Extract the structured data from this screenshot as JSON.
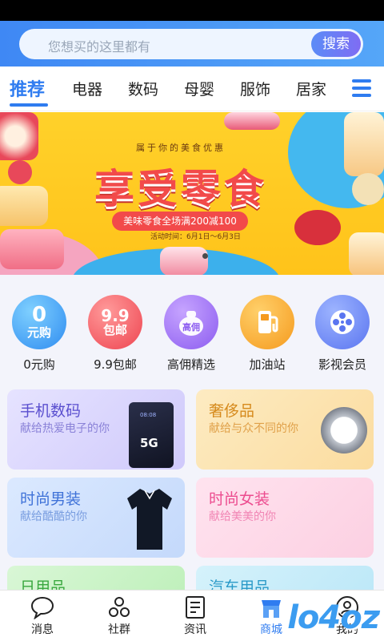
{
  "search": {
    "placeholder": "您想买的这里都有",
    "button": "搜索"
  },
  "tabs": [
    {
      "label": "推荐",
      "active": true
    },
    {
      "label": "电器"
    },
    {
      "label": "数码"
    },
    {
      "label": "母婴"
    },
    {
      "label": "服饰"
    },
    {
      "label": "居家"
    }
  ],
  "banner": {
    "subtitle": "属于你的美食优惠",
    "title": "享受零食",
    "ribbon": "美味零食全场满200减100",
    "date": "活动时间：6月1日～6月3日"
  },
  "quick_icons": [
    {
      "label": "0元购",
      "badge_top": "0",
      "badge_bottom": "元购",
      "color": "#2f8cf0"
    },
    {
      "label": "9.9包邮",
      "badge_top": "9.9",
      "badge_bottom": "包邮",
      "color": "#ee4450"
    },
    {
      "label": "高佣精选",
      "badge_top": "",
      "badge_bottom": "高佣",
      "color": "#8c5cf0"
    },
    {
      "label": "加油站",
      "badge_top": "",
      "badge_bottom": "",
      "color": "#f59a1e"
    },
    {
      "label": "影视会员",
      "badge_top": "",
      "badge_bottom": "",
      "color": "#5a75f0"
    }
  ],
  "cards": [
    {
      "title": "手机数码",
      "subtitle": "献给热爱电子的你",
      "phone_badge": "5G",
      "phone_time": "08:08"
    },
    {
      "title": "奢侈品",
      "subtitle": "献给与众不同的你"
    },
    {
      "title": "时尚男装",
      "subtitle": "献给酷酷的你"
    },
    {
      "title": "时尚女装",
      "subtitle": "献给美美的你"
    },
    {
      "title": "日用品"
    },
    {
      "title": "汽车用品"
    }
  ],
  "bottom_nav": [
    {
      "label": "消息",
      "icon": "chat-bubble-icon"
    },
    {
      "label": "社群",
      "icon": "community-icon"
    },
    {
      "label": "资讯",
      "icon": "news-icon"
    },
    {
      "label": "商城",
      "icon": "shop-icon",
      "active": true
    },
    {
      "label": "我的",
      "icon": "user-icon"
    }
  ],
  "watermark": "lo4oz",
  "colors": {
    "accent": "#2f7cf0",
    "banner_yellow": "#ffc31a",
    "banner_red": "#f24a4a"
  }
}
